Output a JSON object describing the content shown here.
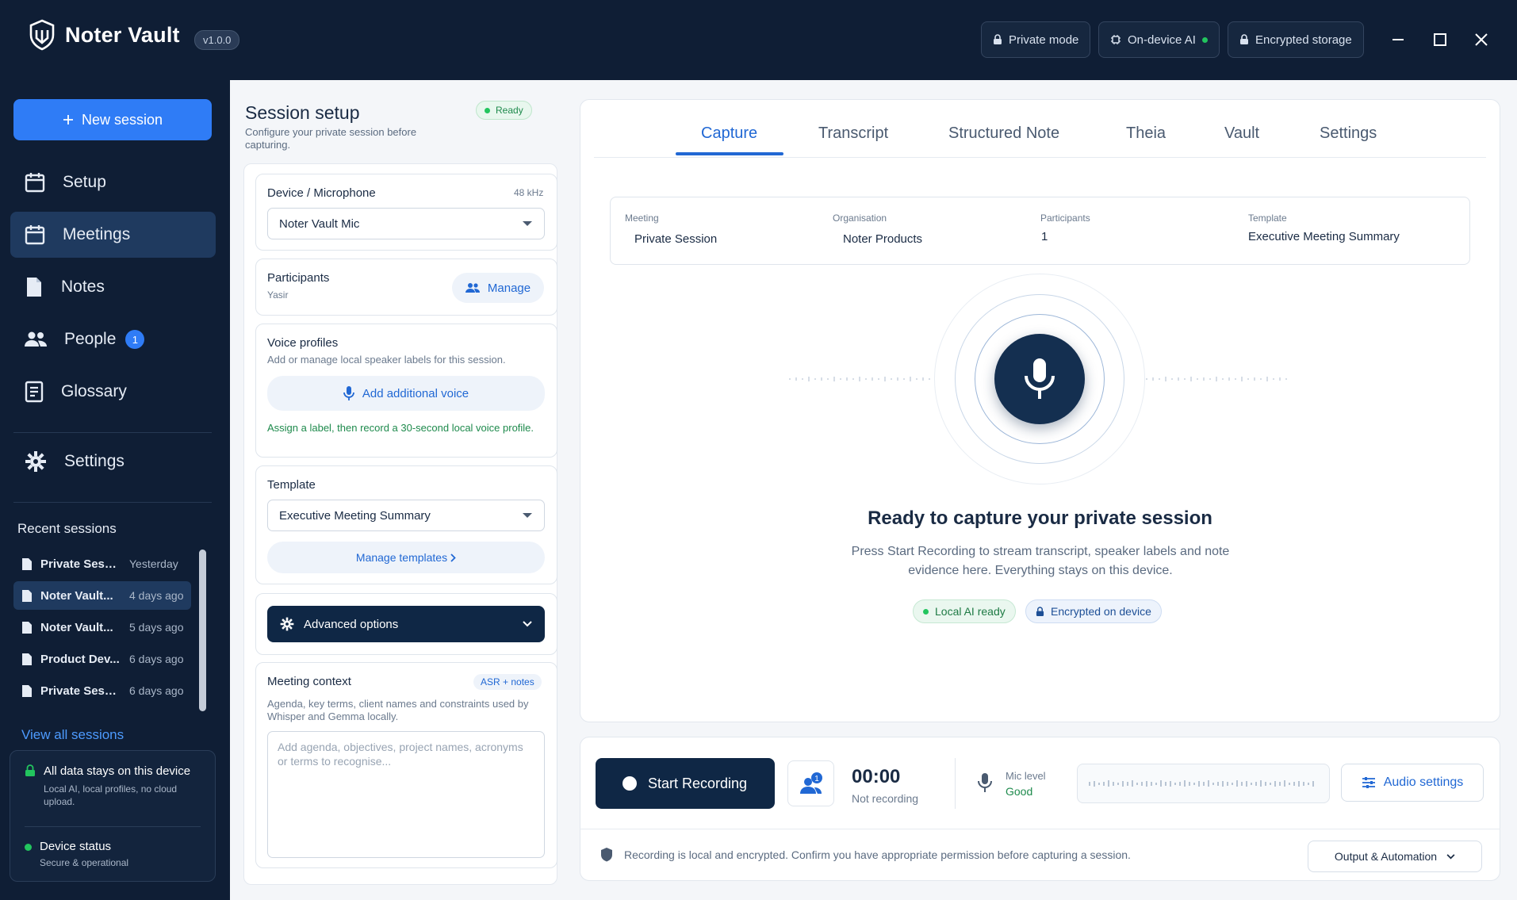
{
  "app": {
    "name": "Noter Vault",
    "version": "v1.0.0"
  },
  "titlebar": {
    "pills": [
      {
        "label": "Private mode",
        "icon": "lock-icon"
      },
      {
        "label": "On-device AI",
        "icon": "chip-icon",
        "status_color": "#22c55e"
      },
      {
        "label": "Encrypted storage",
        "icon": "lock-icon"
      }
    ]
  },
  "sidebar": {
    "new_session": "New session",
    "items": [
      {
        "label": "Setup",
        "icon": "calendar-icon"
      },
      {
        "label": "Meetings",
        "icon": "calendar-icon"
      },
      {
        "label": "Notes",
        "icon": "document-icon"
      },
      {
        "label": "People",
        "icon": "people-icon",
        "badge": "1"
      },
      {
        "label": "Glossary",
        "icon": "glossary-icon"
      },
      {
        "label": "Settings",
        "icon": "gear-icon"
      }
    ],
    "recent_title": "Recent sessions",
    "recent": [
      {
        "name": "Private Sessio...",
        "time": "Yesterday"
      },
      {
        "name": "Noter Vault...",
        "time": "4 days ago"
      },
      {
        "name": "Noter Vault...",
        "time": "5 days ago"
      },
      {
        "name": "Product Dev...",
        "time": "6 days ago"
      },
      {
        "name": "Private Sessi...",
        "time": "6 days ago"
      }
    ],
    "view_all": "View all sessions",
    "privacy_title": "All data stays on this device",
    "privacy_sub": "Local AI, local profiles, no cloud upload.",
    "status_title": "Device status",
    "status_sub": "Secure & operational"
  },
  "setup": {
    "title": "Session setup",
    "status": "Ready",
    "subtitle": "Configure your private session before capturing.",
    "device_label": "Device / Microphone",
    "device_rate": "48 kHz",
    "device_value": "Noter Vault Mic",
    "participants_label": "Participants",
    "participants_value": "Yasir",
    "manage": "Manage",
    "voice_label": "Voice profiles",
    "voice_desc": "Add or manage local speaker labels for this session.",
    "add_voice": "Add additional voice",
    "voice_hint": "Assign a label, then record a 30-second local voice profile.",
    "template_label": "Template",
    "template_value": "Executive Meeting Summary",
    "manage_templates": "Manage templates",
    "advanced": "Advanced options",
    "context_label": "Meeting context",
    "context_badge": "ASR + notes",
    "context_desc": "Agenda, key terms, client names and constraints used by Whisper and Gemma locally.",
    "context_placeholder": "Add agenda, objectives, project names, acronyms or terms to recognise..."
  },
  "tabs": [
    "Capture",
    "Transcript",
    "Structured Note",
    "Theia",
    "Vault",
    "Settings"
  ],
  "meta": {
    "meeting_label": "Meeting",
    "meeting_value": "Private Session",
    "org_label": "Organisation",
    "org_value": "Noter Products",
    "participants_label": "Participants",
    "participants_value": "1",
    "template_label": "Template",
    "template_value": "Executive Meeting Summary"
  },
  "capture": {
    "heading": "Ready to capture your private session",
    "body": "Press Start Recording to stream transcript, speaker labels and note evidence here. Everything stays on this device.",
    "chip_ai": "Local AI ready",
    "chip_enc": "Encrypted on device"
  },
  "recording": {
    "start": "Start Recording",
    "timer": "00:00",
    "timer_status": "Not recording",
    "mic_label": "Mic level",
    "mic_value": "Good",
    "audio_settings": "Audio settings",
    "notice": "Recording is local and encrypted. Confirm you have appropriate permission before capturing a session.",
    "output": "Output & Automation",
    "speaker_badge": "1"
  },
  "colors": {
    "accent": "#2168d4",
    "brand_dark": "#0f1e35",
    "success": "#22c55e"
  }
}
